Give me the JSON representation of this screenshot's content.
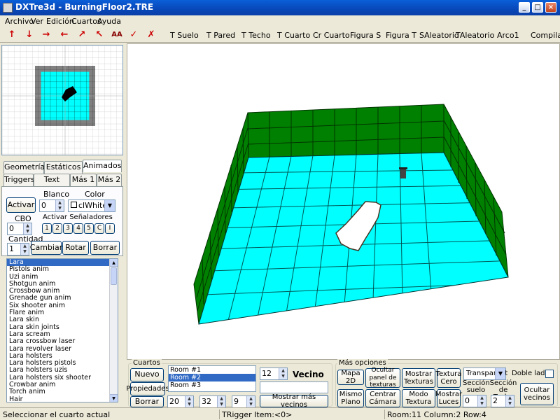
{
  "window": {
    "title": "DXTre3d - BurningFloor2.TRE",
    "minimize": "_",
    "maximize": "□",
    "close": "×"
  },
  "menu": [
    "Archivo",
    "Ver",
    "Edición",
    "Cuartos",
    "Ayuda"
  ],
  "toolbar": {
    "icons": [
      "arrow-up-icon",
      "arrow-down-icon",
      "arrow-right-icon",
      "arrow-left-icon",
      "arrow-up-right-icon",
      "arrow-up-left-icon",
      "double-a-icon",
      "check-icon",
      "x-icon"
    ],
    "icon_glyphs": [
      "↑",
      "↓",
      "→",
      "←",
      "↗",
      "↖",
      "AA",
      "✓",
      "✗"
    ],
    "buttons": [
      "T Suelo",
      "T Pared",
      "T Techo",
      "T Cuarto",
      "Cr Cuarto",
      "Figura S",
      "Figura T",
      "SAleatorio",
      "TAleatorio",
      "Arco1",
      "Compilar"
    ]
  },
  "tabs": {
    "row1": [
      "Geometría",
      "Estáticos",
      "Animados"
    ],
    "row2": [
      "Triggers",
      "Text Anim",
      "Más 1",
      "Más 2"
    ],
    "active": "Animados"
  },
  "animados": {
    "activar_label": "Activar",
    "blanco_label": "Blanco",
    "blanco_value": "0",
    "color_label": "Color",
    "color_value": "clWhite",
    "cbo_label": "CBO",
    "cbo_value": "0",
    "senaladores_label": "Activar Señaladores",
    "senaladores": [
      "1",
      "2",
      "3",
      "4",
      "5",
      "C",
      "I"
    ],
    "cantidad_label": "Cantidad",
    "cantidad_value": "1",
    "cambiar_label": "Cambiar",
    "rotar_label": "Rotar",
    "borrar_label": "Borrar"
  },
  "objects": [
    "Lara",
    "Pistols anim",
    "Uzi anim",
    "Shotgun anim",
    "Crossbow anim",
    "Grenade gun anim",
    "Six shooter anim",
    "Flare anim",
    "Lara skin",
    "Lara skin joints",
    "Lara scream",
    "Lara crossbow laser",
    "Lara revolver laser",
    "Lara holsters",
    "Lara holsters pistols",
    "Lara holsters uzis",
    "Lara holsters six shooter",
    "Crowbar anim",
    "Torch anim",
    "Hair"
  ],
  "objects_selected": 0,
  "cuartos": {
    "label": "Cuartos",
    "nuevo": "Nuevo",
    "propiedades": "Propiedades",
    "borrar": "Borrar",
    "rooms": [
      "Room #1",
      "Room #2",
      "Room #3"
    ],
    "selected": 1,
    "vecino_value": "12",
    "vecino_label": "Vecino",
    "x_value": "20",
    "y_value": "32",
    "z_value": "9",
    "mostrar_vecinos": "Mostrar más vecinos"
  },
  "mas_opciones": {
    "label": "Más opciones",
    "mapa2d": "Mapa 2D",
    "ocultar_panel": "Ocultar panel de texturas",
    "mostrar_texturas": "Mostrar Texturas",
    "textura_cero": "Textura Cero",
    "transparent": "Transparent",
    "doble_lado": "Doble lado",
    "mismo_plano": "Mismo Plano",
    "centrar_camara": "Centrar Cámara",
    "modo_textura": "Modo Textura",
    "mostrar_luces": "Mostrar Luces",
    "seccion_suelo_label": "Sección suelo",
    "seccion_suelo_value": "0",
    "seccion_techo_label": "Sección de Techo",
    "seccion_techo_value": "2",
    "ocultar_vecinos": "Ocultar vecinos"
  },
  "status": {
    "left": "Seleccionar el cuarto actual",
    "trigger": "TRigger Item:<0>",
    "room": "Room:11 Column:2 Row:4"
  },
  "colors": {
    "floor": "#00ffff",
    "wall": "#008000",
    "wall_top": "#008000",
    "grid": "#003333",
    "minimap_border": "#808080",
    "minimap_floor": "#00ffff"
  }
}
